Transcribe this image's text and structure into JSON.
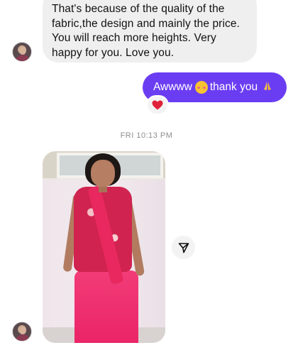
{
  "thread": {
    "incoming_message": {
      "lines": [
        "That's because of the quality of the",
        "fabric,the design and mainly the price.",
        "You will reach more heights. Very",
        "happy for you. Love you."
      ]
    },
    "outgoing_message": {
      "text_before_emoji": "Awwww",
      "text_after_emoji": "thank you",
      "emoji_names": [
        "smiling-face-with-hearts-icon",
        "folded-hands-icon"
      ],
      "bubble_color": "#6b3df2",
      "text_color": "#ffffff"
    },
    "reaction": {
      "icon": "red-heart-icon",
      "color": "#e0213a"
    },
    "timestamp": "FRI 10:13 PM",
    "photo_message": {
      "subject": "photo-attachment"
    },
    "share_icon": "paper-plane-icon"
  },
  "colors": {
    "incoming_bubble": "#efefef",
    "timestamp": "#8e8e8e"
  }
}
